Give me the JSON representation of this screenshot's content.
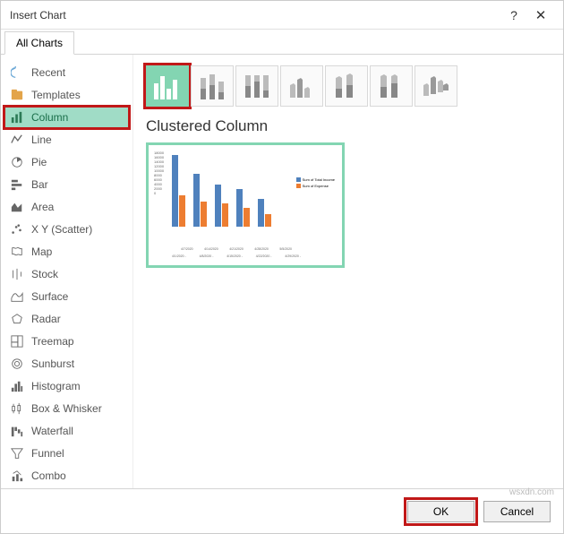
{
  "window": {
    "title": "Insert Chart"
  },
  "tabs": {
    "active": "All Charts"
  },
  "sidebar": {
    "items": [
      {
        "label": "Recent",
        "icon": "recent"
      },
      {
        "label": "Templates",
        "icon": "templates"
      },
      {
        "label": "Column",
        "icon": "column"
      },
      {
        "label": "Line",
        "icon": "line"
      },
      {
        "label": "Pie",
        "icon": "pie"
      },
      {
        "label": "Bar",
        "icon": "bar"
      },
      {
        "label": "Area",
        "icon": "area"
      },
      {
        "label": "X Y (Scatter)",
        "icon": "scatter"
      },
      {
        "label": "Map",
        "icon": "map"
      },
      {
        "label": "Stock",
        "icon": "stock"
      },
      {
        "label": "Surface",
        "icon": "surface"
      },
      {
        "label": "Radar",
        "icon": "radar"
      },
      {
        "label": "Treemap",
        "icon": "treemap"
      },
      {
        "label": "Sunburst",
        "icon": "sunburst"
      },
      {
        "label": "Histogram",
        "icon": "histogram"
      },
      {
        "label": "Box & Whisker",
        "icon": "box"
      },
      {
        "label": "Waterfall",
        "icon": "waterfall"
      },
      {
        "label": "Funnel",
        "icon": "funnel"
      },
      {
        "label": "Combo",
        "icon": "combo"
      }
    ]
  },
  "preview": {
    "title": "Clustered Column",
    "legend": {
      "s1": "Sum of Total Income",
      "s2": "Sum of Expense"
    }
  },
  "buttons": {
    "ok": "OK",
    "cancel": "Cancel"
  },
  "chart_data": {
    "type": "bar",
    "categories": [
      "4/1/2020 - 4/7/2020",
      "4/8/2020 - 4/14/2020",
      "4/15/2020 - 4/21/2020",
      "4/22/2020 - 4/28/2020",
      "4/29/2020 - 5/5/2020"
    ],
    "series": [
      {
        "name": "Sum of Total Income",
        "values": [
          17000,
          12500,
          10000,
          9000,
          6500
        ]
      },
      {
        "name": "Sum of Expense",
        "values": [
          7500,
          6000,
          5500,
          4500,
          3000
        ]
      }
    ],
    "ylim": [
      0,
      18000
    ],
    "title": "",
    "xlabel": "",
    "ylabel": ""
  },
  "watermark": "wsxdn.com"
}
